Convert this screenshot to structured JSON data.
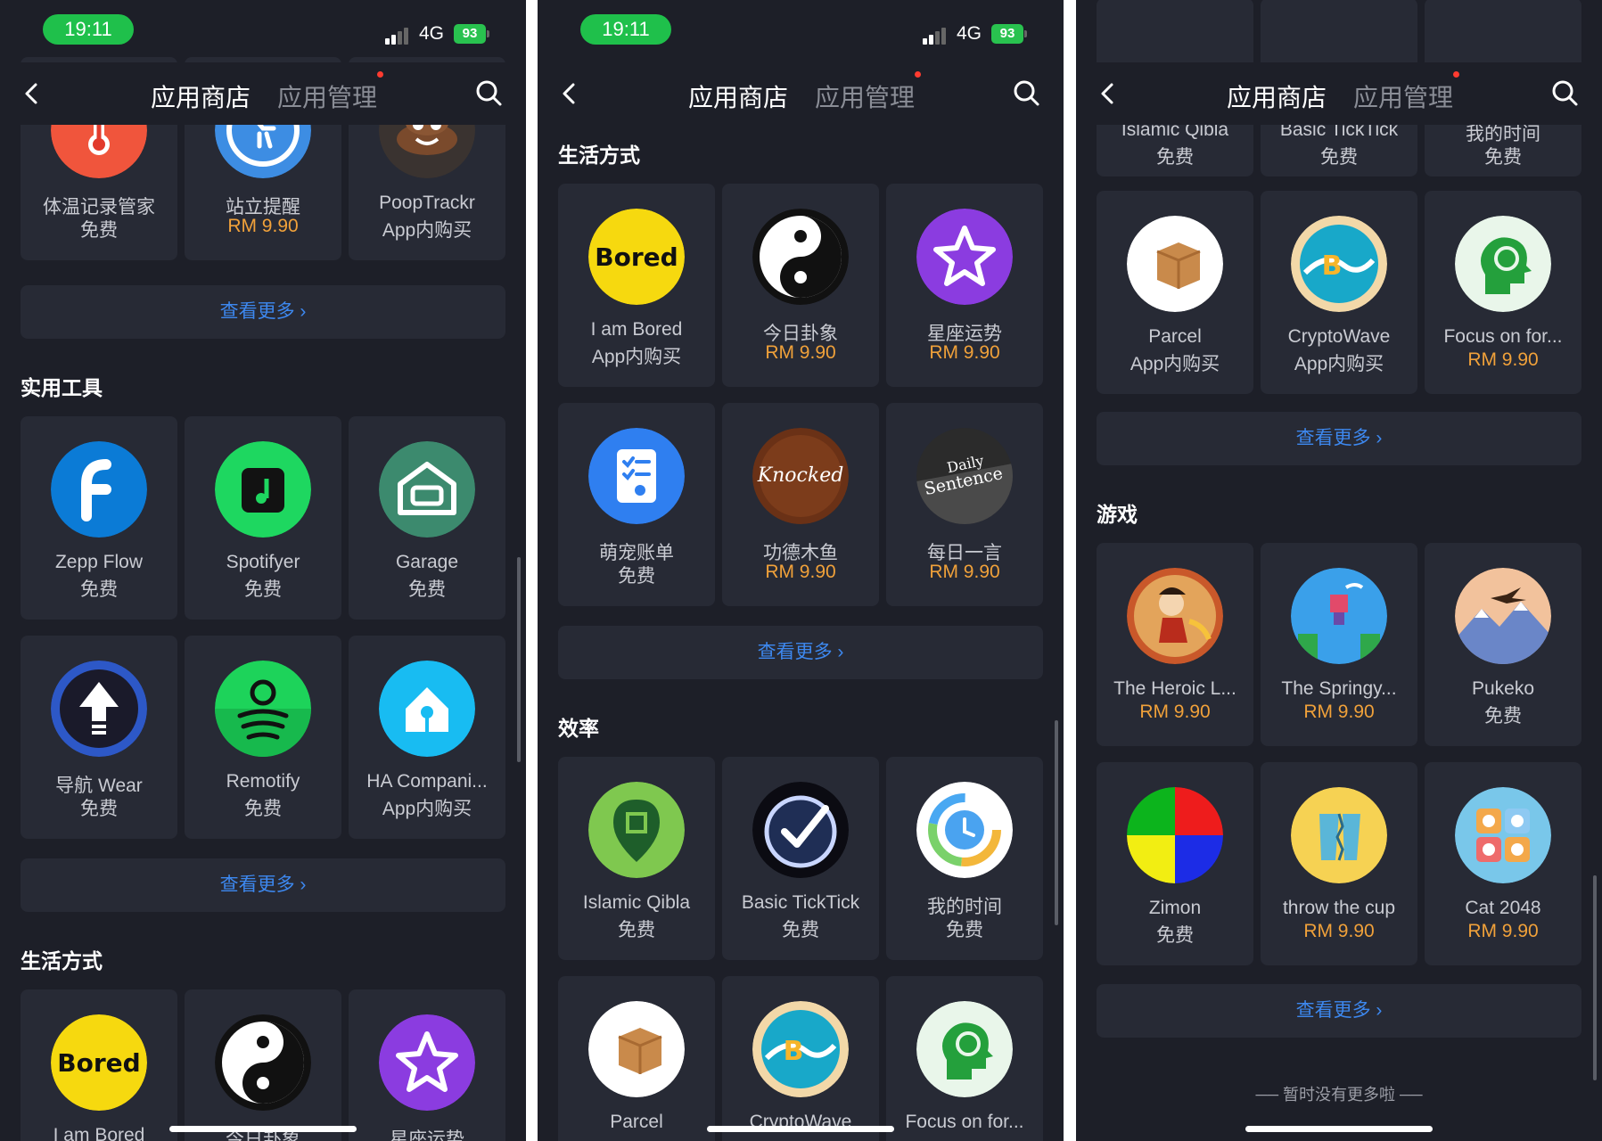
{
  "status": {
    "time": "19:11",
    "network": "4G",
    "battery": "93"
  },
  "nav": {
    "store_tab": "应用商店",
    "manage_tab": "应用管理"
  },
  "more_label": "查看更多 ›",
  "end_text": "── 暂时没有更多啦 ──",
  "sections": {
    "tools": "实用工具",
    "lifestyle": "生活方式",
    "efficiency": "效率",
    "games": "游戏"
  },
  "apps": {
    "temp": {
      "name": "体温记录管家",
      "price": "免费"
    },
    "stand": {
      "name": "站立提醒",
      "price": "RM 9.90"
    },
    "poop": {
      "name": "PoopTrackr",
      "price": "App内购买"
    },
    "zepp": {
      "name": "Zepp Flow",
      "price": "免费"
    },
    "spotifyer": {
      "name": "Spotifyer",
      "price": "免费"
    },
    "garage": {
      "name": "Garage",
      "price": "免费"
    },
    "navwear": {
      "name": "导航 Wear",
      "price": "免费"
    },
    "remotify": {
      "name": "Remotify",
      "price": "免费"
    },
    "ha": {
      "name": "HA Compani...",
      "price": "App内购买"
    },
    "bored": {
      "name": "I am Bored",
      "price": "App内购买",
      "partial_name": "I am Bored"
    },
    "gua": {
      "name": "今日卦象",
      "price": "RM 9.90",
      "partial_name": "今日卦象"
    },
    "star": {
      "name": "星座运势",
      "price": "RM 9.90",
      "partial_name": "星座运势"
    },
    "pet": {
      "name": "萌宠账单",
      "price": "免费"
    },
    "knock": {
      "name": "功德木鱼",
      "price": "RM 9.90"
    },
    "daily": {
      "name": "每日一言",
      "price": "RM 9.90"
    },
    "qibla": {
      "name": "Islamic Qibla",
      "price": "免费"
    },
    "tick": {
      "name": "Basic TickTick",
      "price": "免费"
    },
    "mytime": {
      "name": "我的时间",
      "price": "免费"
    },
    "parcel": {
      "name": "Parcel",
      "price": "App内购买"
    },
    "crypto": {
      "name": "CryptoWave",
      "price": "App内购买"
    },
    "focus": {
      "name": "Focus on for...",
      "price": "RM 9.90"
    },
    "heroic": {
      "name": "The Heroic L...",
      "price": "RM 9.90"
    },
    "springy": {
      "name": "The Springy...",
      "price": "RM 9.90"
    },
    "pukeko": {
      "name": "Pukeko",
      "price": "免费"
    },
    "zimon": {
      "name": "Zimon",
      "price": "免费"
    },
    "cup": {
      "name": "throw the cup",
      "price": "RM 9.90"
    },
    "cat": {
      "name": "Cat 2048",
      "price": "RM 9.90"
    }
  },
  "colors": {
    "bg": "#1d1f28",
    "card": "#272a35",
    "accent": "#3d88ef",
    "price": "#f0a13a",
    "time_pill": "#1fc04b"
  }
}
